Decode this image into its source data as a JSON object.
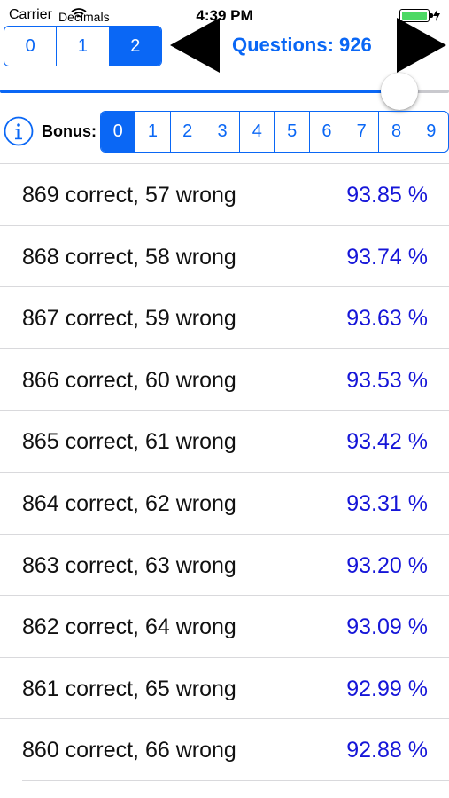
{
  "status_bar": {
    "carrier": "Carrier",
    "app_name": "Decimals",
    "time": "4:39 PM"
  },
  "decimals_selector": {
    "options": [
      "0",
      "1",
      "2"
    ],
    "selected_index": 2
  },
  "questions": {
    "label": "Questions: 926",
    "slider_fraction": 0.89
  },
  "bonus": {
    "label": "Bonus:",
    "options": [
      "0",
      "1",
      "2",
      "3",
      "4",
      "5",
      "6",
      "7",
      "8",
      "9"
    ],
    "selected_index": 0
  },
  "results": [
    {
      "counts": "869 correct, 57 wrong",
      "percent": "93.85 %"
    },
    {
      "counts": "868 correct, 58 wrong",
      "percent": "93.74 %"
    },
    {
      "counts": "867 correct, 59 wrong",
      "percent": "93.63 %"
    },
    {
      "counts": "866 correct, 60 wrong",
      "percent": "93.53 %"
    },
    {
      "counts": "865 correct, 61 wrong",
      "percent": "93.42 %"
    },
    {
      "counts": "864 correct, 62 wrong",
      "percent": "93.31 %"
    },
    {
      "counts": "863 correct, 63 wrong",
      "percent": "93.20 %"
    },
    {
      "counts": "862 correct, 64 wrong",
      "percent": "93.09 %"
    },
    {
      "counts": "861 correct, 65 wrong",
      "percent": "92.99 %"
    },
    {
      "counts": "860 correct, 66 wrong",
      "percent": "92.88 %"
    }
  ],
  "colors": {
    "accent": "#0a67f5",
    "percent_text": "#1515d8",
    "battery": "#4cd964"
  },
  "icons": {
    "wifi": "wifi-icon",
    "battery": "battery-icon",
    "charging": "charging-icon",
    "previous": "triangle-left-icon",
    "next": "triangle-right-icon",
    "info": "info-icon"
  }
}
